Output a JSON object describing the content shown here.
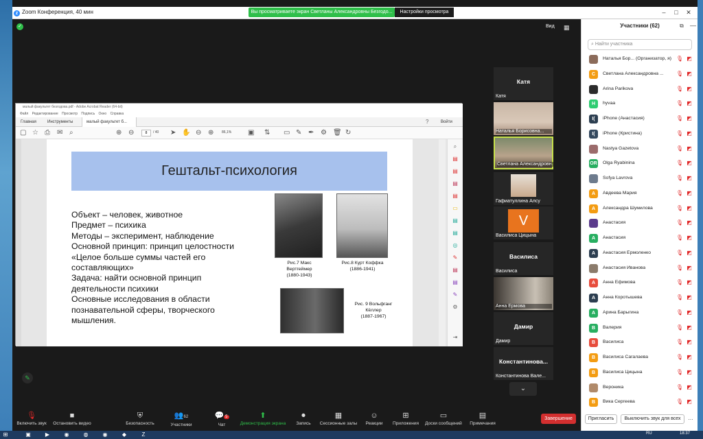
{
  "window": {
    "title": "Zoom Конференция, 40 мин",
    "share_banner": "Вы просматриваете экран Светланы Александровны Безгодо...",
    "view_options": "Настройки просмотра",
    "view_button": "Вид"
  },
  "acrobat": {
    "title_bar": "малый факультет безгодова.pdf - Adobe Acrobat Reader (64-bit)",
    "menu": "Файл Редактирование Просмотр Подпись Окно Справка",
    "tabs": [
      "Главная",
      "Инструменты",
      "малый факультет б..."
    ],
    "login": "Войти",
    "page_current": "8",
    "page_total": "/ 40",
    "zoom": "86,1%"
  },
  "slide": {
    "title": "Гештальт-психология",
    "lines": [
      "Объект – человек, животное",
      "Предмет – психика",
      "Методы – эксперимент, наблюдение",
      "Основной принцип: принцип целостности",
      "«Целое больше суммы частей его",
      "составляющих»",
      "Задача: найти основной принцип",
      "деятельности психики",
      "Основные исследования в области",
      "познавательной сферы, творческого",
      "мышления."
    ],
    "captions": [
      [
        "Рис.7 Макс",
        "Вертгеймер",
        "(1880-1943)"
      ],
      [
        "Рис.8 Курт Коффка",
        "(1886-1941)"
      ],
      [
        "Рис. 9 Вольфганг",
        "Кёллер",
        "(1887-1967)"
      ]
    ]
  },
  "video_tiles": [
    {
      "big": "Катя",
      "name": "Катя"
    },
    {
      "big": "",
      "name": "Наталья Борисовна..."
    },
    {
      "big": "",
      "name": "Светлана Александровн..."
    },
    {
      "big": "",
      "name": "Гафиатуллина Алсу"
    },
    {
      "big": "",
      "name": "Василиса Цицына"
    },
    {
      "big": "Василиса",
      "name": "Василиса"
    },
    {
      "big": "",
      "name": "Анна Ермова"
    },
    {
      "big": "Дамир",
      "name": "Дамир"
    },
    {
      "big": "Константинова...",
      "name": "Константинова Вале..."
    }
  ],
  "participants": {
    "title": "Участники (62)",
    "search_placeholder": "Найти участника",
    "list": [
      {
        "initial": "",
        "name": "Наталья Бор... (Организатор, я)",
        "color": "#8b6b5a"
      },
      {
        "initial": "С",
        "name": "Светлана Александровна ...",
        "color": "#f39c12"
      },
      {
        "initial": "",
        "name": "Arina Parikova",
        "color": "#2b2b2b"
      },
      {
        "initial": "H",
        "name": "hyvaa",
        "color": "#2ecc71"
      },
      {
        "initial": "I(",
        "name": "iPhone (Анастасия)",
        "color": "#2c3e50"
      },
      {
        "initial": "I(",
        "name": "iPhone (Кристина)",
        "color": "#34495e"
      },
      {
        "initial": "",
        "name": "Nastya Gazetova",
        "color": "#9b6b6b"
      },
      {
        "initial": "OR",
        "name": "Olga Ryabinina",
        "color": "#27ae60"
      },
      {
        "initial": "",
        "name": "Sofya Lavrova",
        "color": "#6d7b8d"
      },
      {
        "initial": "А",
        "name": "Авдеева Мария",
        "color": "#f39c12"
      },
      {
        "initial": "А",
        "name": "Александра Шумилова",
        "color": "#f39c12"
      },
      {
        "initial": "",
        "name": "Анастасия",
        "color": "#5b3b8c"
      },
      {
        "initial": "А",
        "name": "Анастасия",
        "color": "#27ae60"
      },
      {
        "initial": "А",
        "name": "Анастасия Ермоленко",
        "color": "#2c3e50"
      },
      {
        "initial": "",
        "name": "Анастасия Иванова",
        "color": "#8b7b6b"
      },
      {
        "initial": "А",
        "name": "Анна Ефимова",
        "color": "#e74c3c"
      },
      {
        "initial": "А",
        "name": "Анна Коротышева",
        "color": "#2c3e50"
      },
      {
        "initial": "А",
        "name": "Арина Барыгина",
        "color": "#27ae60"
      },
      {
        "initial": "В",
        "name": "Валерия",
        "color": "#27ae60"
      },
      {
        "initial": "В",
        "name": "Василиса",
        "color": "#e74c3c"
      },
      {
        "initial": "В",
        "name": "Василиса Сагалаева",
        "color": "#f39c12"
      },
      {
        "initial": "В",
        "name": "Василиса Цицына",
        "color": "#f39c12"
      },
      {
        "initial": "",
        "name": "Вероника",
        "color": "#b08a6a"
      },
      {
        "initial": "В",
        "name": "Вика Сергеева",
        "color": "#f39c12"
      }
    ],
    "invite": "Пригласить",
    "mute_all": "Выключить звук для всех"
  },
  "toolbar": {
    "items": [
      "Включить звук",
      "Остановить видео",
      "Безопасность",
      "Участники",
      "Чат",
      "Демонстрация экрана",
      "Запись",
      "Сессионные залы",
      "Реакции",
      "Приложения",
      "Доски сообщений",
      "Примечания"
    ],
    "participants_count": "62",
    "chat_badge": "5",
    "end": "Завершение"
  },
  "taskbar": {
    "lang": "RU",
    "time": "18:37"
  }
}
